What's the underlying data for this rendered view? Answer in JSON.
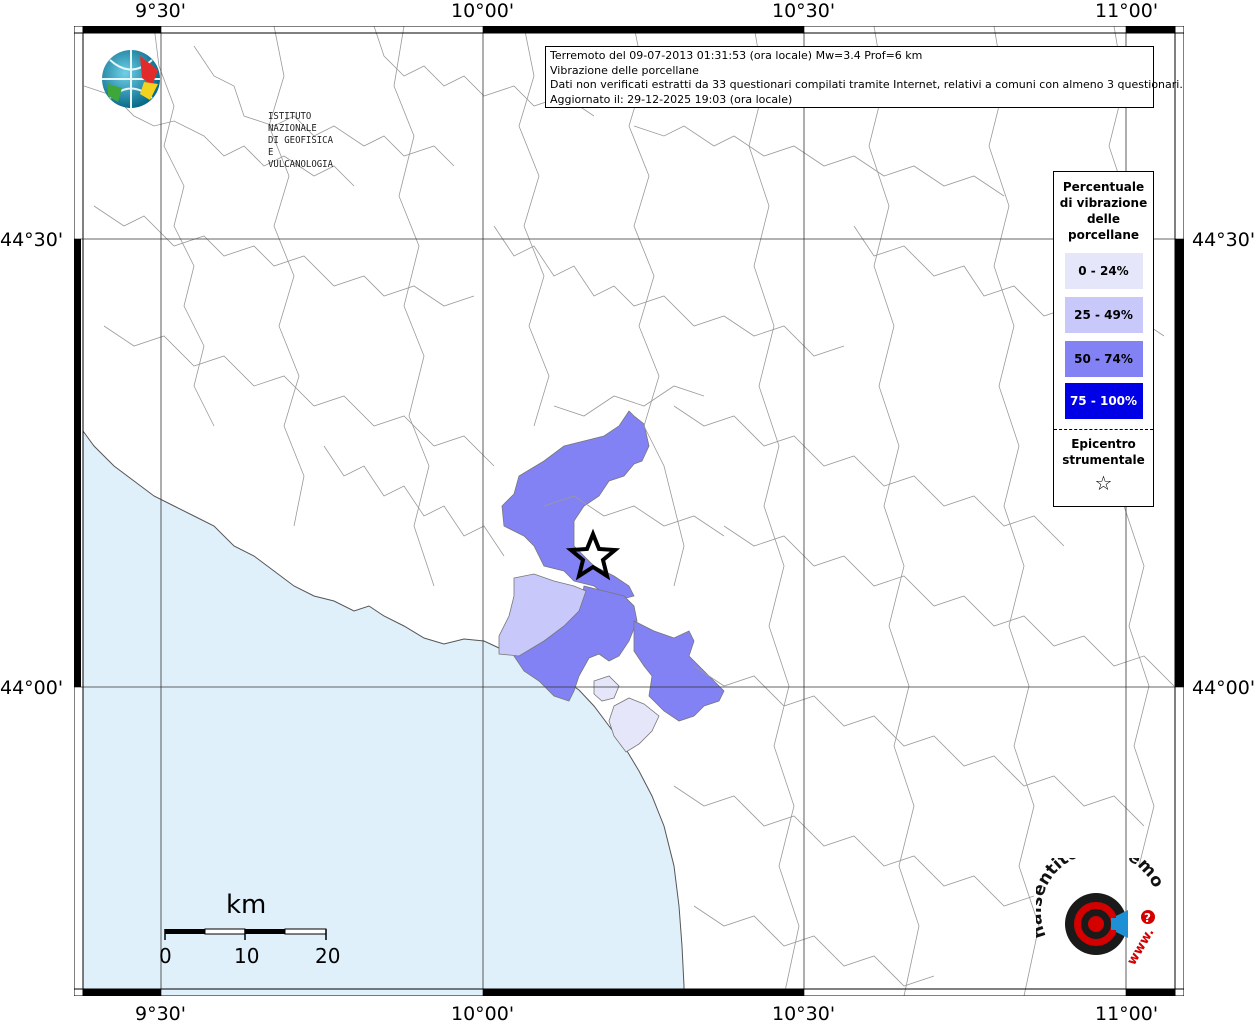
{
  "info": {
    "line1": "Terremoto del 09-07-2013 01:31:53 (ora locale) Mw=3.4 Prof=6 km",
    "line2": "Vibrazione delle porcellane",
    "line3": "Dati non verificati estratti da 33 questionari compilati tramite Internet, relativi a comuni con almeno 3 questionari.",
    "line4": "Aggiornato il: 29-12-2025 19:03 (ora locale)"
  },
  "logo": {
    "line1": "ISTITUTO NAZIONALE",
    "line2": "DI GEOFISICA E VULCANOLOGIA"
  },
  "axes": {
    "top": [
      "9°30'",
      "10°00'",
      "10°30'",
      "11°00'"
    ],
    "bottom": [
      "9°30'",
      "10°00'",
      "10°30'",
      "11°00'"
    ],
    "left": [
      "44°30'",
      "44°00'"
    ],
    "right": [
      "44°30'",
      "44°00'"
    ]
  },
  "legend": {
    "title": "Percentuale di vibrazione delle porcellane",
    "items": [
      {
        "label": "0 - 24%",
        "color": "#e6e6fa"
      },
      {
        "label": "25 - 49%",
        "color": "#c8c8fa"
      },
      {
        "label": "50 - 74%",
        "color": "#8282f5"
      },
      {
        "label": "75 - 100%",
        "color": "#0000e6"
      }
    ],
    "epicenter": "Epicentro strumentale",
    "star": "☆"
  },
  "scale": {
    "title": "km",
    "labels": [
      "0",
      "10",
      "20"
    ]
  },
  "hst_logo": {
    "text": "haisentitoilterremoto.it",
    "www": "www.",
    "q": "?"
  },
  "colors": {
    "sea": "#dff0fb",
    "land": "#ffffff",
    "borders": "#9a9a9a",
    "grid": "#333333",
    "class_0_24": "#e6e6fa",
    "class_25_49": "#c8c8fa",
    "class_50_74": "#8282f5",
    "class_75_100": "#0000e6",
    "hst_red": "#d40000"
  },
  "epicenter": {
    "lon": 10.18,
    "lat": 44.16
  }
}
